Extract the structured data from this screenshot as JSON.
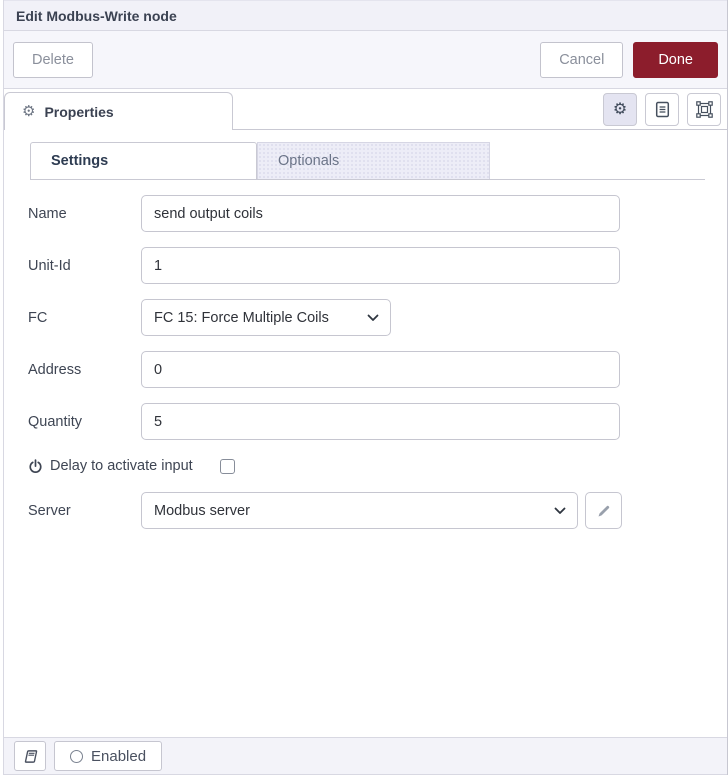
{
  "header": {
    "title": "Edit Modbus-Write node"
  },
  "toolbar": {
    "delete_label": "Delete",
    "cancel_label": "Cancel",
    "done_label": "Done"
  },
  "editor_tabs": {
    "properties_label": "Properties",
    "icon_tray": [
      {
        "name": "gear-icon",
        "active": true
      },
      {
        "name": "document-icon",
        "active": false
      },
      {
        "name": "appearance-icon",
        "active": false
      }
    ]
  },
  "tabs": {
    "settings_label": "Settings",
    "optionals_label": "Optionals"
  },
  "form": {
    "name": {
      "label": "Name",
      "value": "send output coils"
    },
    "unit_id": {
      "label": "Unit-Id",
      "value": "1"
    },
    "fc": {
      "label": "FC",
      "value": "FC 15: Force Multiple Coils"
    },
    "address": {
      "label": "Address",
      "value": "0"
    },
    "quantity": {
      "label": "Quantity",
      "value": "5"
    },
    "delay": {
      "label": "Delay to activate input",
      "checked": false
    },
    "server": {
      "label": "Server",
      "value": "Modbus server"
    }
  },
  "footer": {
    "enabled_label": "Enabled"
  },
  "icons": {
    "gear": "⚙",
    "names": [
      "gear-icon",
      "document-icon",
      "appearance-icon",
      "chevron-down-icon",
      "power-icon",
      "pencil-icon",
      "book-icon",
      "circle-icon"
    ]
  },
  "colors": {
    "accent_red": "#8C1D2C",
    "panel_bg": "#f2f2f9",
    "active_icon_bg": "#e4e4f1",
    "border": "#c9c9d3"
  }
}
